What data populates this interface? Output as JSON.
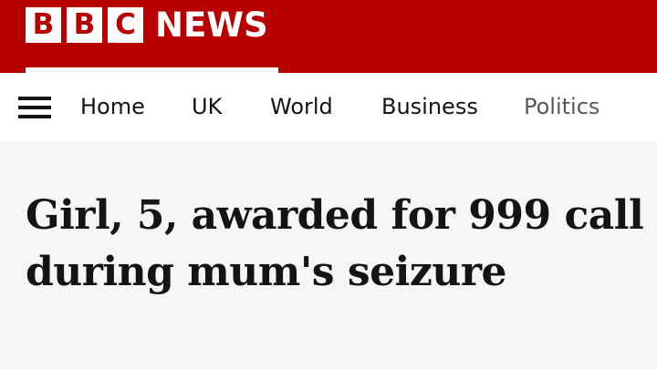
{
  "brand": {
    "logo_letters": [
      "B",
      "B",
      "C"
    ],
    "news_label": "NEWS",
    "color_primary": "#b80000",
    "color_text": "#141414"
  },
  "nav": {
    "menu_icon": "hamburger-menu-icon",
    "items": [
      {
        "label": "Home"
      },
      {
        "label": "UK"
      },
      {
        "label": "World"
      },
      {
        "label": "Business"
      },
      {
        "label": "Politics"
      }
    ]
  },
  "article": {
    "headline": "Girl, 5, awarded for 999 call during mum's seizure"
  }
}
